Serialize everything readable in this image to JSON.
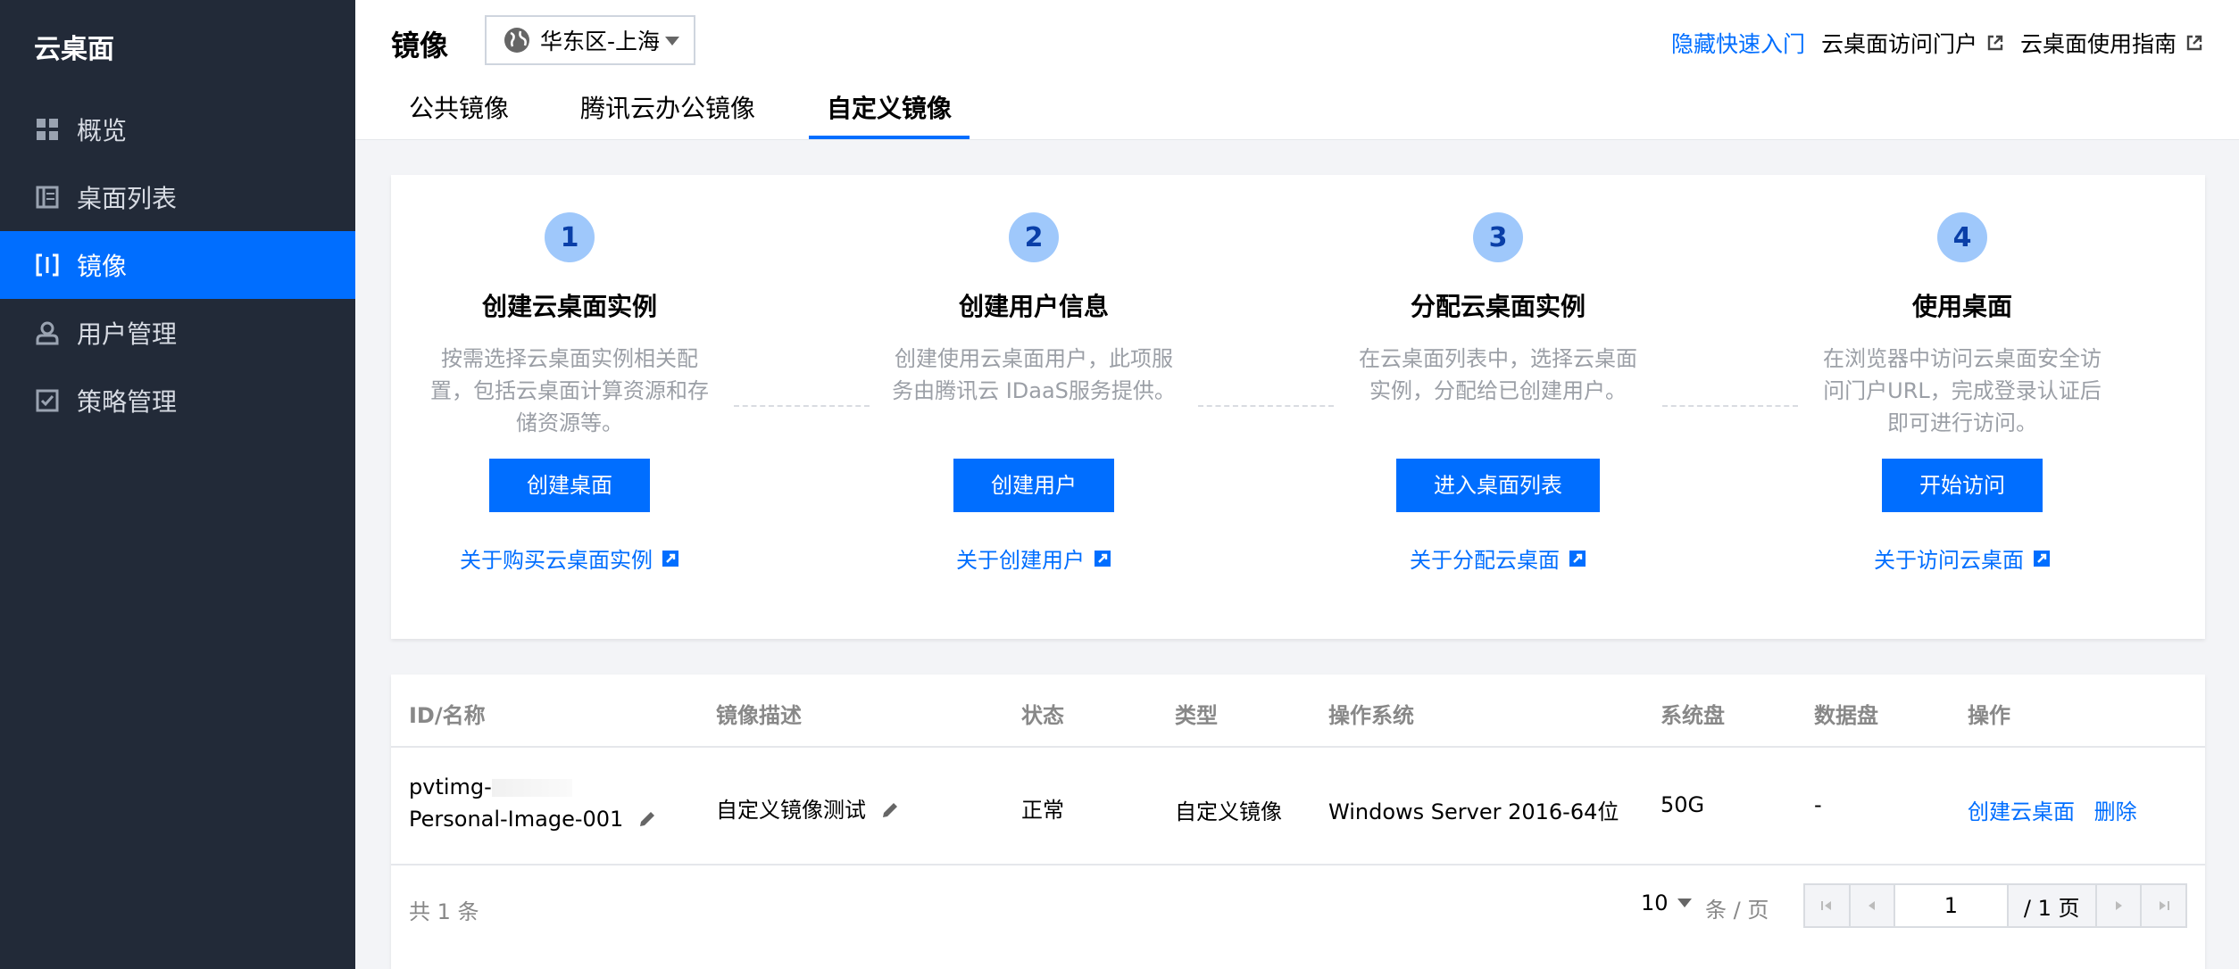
{
  "sidebar": {
    "brand": "云桌面",
    "items": [
      {
        "label": "概览",
        "icon": "overview-icon"
      },
      {
        "label": "桌面列表",
        "icon": "list-icon"
      },
      {
        "label": "镜像",
        "icon": "image-icon",
        "active": true
      },
      {
        "label": "用户管理",
        "icon": "user-icon"
      },
      {
        "label": "策略管理",
        "icon": "policy-icon"
      }
    ]
  },
  "header": {
    "title": "镜像",
    "region": "华东区-上海",
    "links": {
      "hide_quick": "隐藏快速入门",
      "portal": "云桌面访问门户",
      "guide": "云桌面使用指南"
    },
    "tabs": [
      "公共镜像",
      "腾讯云办公镜像",
      "自定义镜像"
    ],
    "active_tab": "自定义镜像"
  },
  "steps": [
    {
      "num": "1",
      "title": "创建云桌面实例",
      "desc": "按需选择云桌面实例相关配置，包括云桌面计算资源和存储资源等。",
      "button": "创建桌面",
      "about": "关于购买云桌面实例"
    },
    {
      "num": "2",
      "title": "创建用户信息",
      "desc": "创建使用云桌面用户，此项服务由腾讯云 IDaaS服务提供。",
      "button": "创建用户",
      "about": "关于创建用户"
    },
    {
      "num": "3",
      "title": "分配云桌面实例",
      "desc": "在云桌面列表中，选择云桌面实例，分配给已创建用户。",
      "button": "进入桌面列表",
      "about": "关于分配云桌面"
    },
    {
      "num": "4",
      "title": "使用桌面",
      "desc": "在浏览器中访问云桌面安全访问门户URL，完成登录认证后即可进行访问。",
      "button": "开始访问",
      "about": "关于访问云桌面"
    }
  ],
  "table": {
    "columns": [
      "ID/名称",
      "镜像描述",
      "状态",
      "类型",
      "操作系统",
      "系统盘",
      "数据盘",
      "操作"
    ],
    "rows": [
      {
        "id": "pvtimg-",
        "name": "Personal-Image-001",
        "desc": "自定义镜像测试",
        "status": "正常",
        "type": "自定义镜像",
        "os": "Windows Server 2016-64位",
        "sys_disk": "50G",
        "data_disk": "-",
        "ops": [
          "创建云桌面",
          "删除"
        ]
      }
    ]
  },
  "pagination": {
    "total": "共 1 条",
    "page_size": "10",
    "per_page": "条 / 页",
    "current": "1",
    "total_pages": "/ 1 页"
  },
  "colors": {
    "accent": "#006eff",
    "sidebar": "#222a38",
    "step_circle": "#9fc8fb"
  }
}
